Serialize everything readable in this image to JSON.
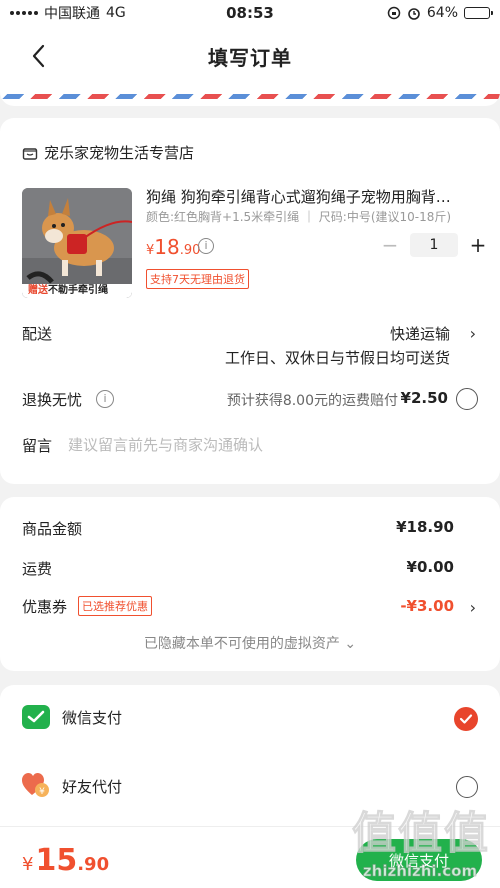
{
  "status_bar": {
    "carrier": "中国联通",
    "network": "4G",
    "time": "08:53",
    "battery": "64%",
    "battery_level": 0.64
  },
  "nav": {
    "title": "填写订单"
  },
  "shop": {
    "name": "宠乐家宠物生活专营店"
  },
  "product": {
    "title": "狗绳 狗狗牵引绳背心式遛狗绳子宠物用胸背…",
    "spec": "颜色:红色胸背+1.5米牵引绳 ｜ 尺码:中号(建议10-18斤)",
    "price_symbol": "¥",
    "price_int": "18",
    "price_dec": ".90",
    "quantity": "1",
    "return_badge": "支持7天无理由退货",
    "image_caption_red": "赠送",
    "image_caption": "不勒手牵引绳"
  },
  "delivery": {
    "label": "配送",
    "method": "快递运输",
    "note": "工作日、双休日与节假日均可送货"
  },
  "exchange": {
    "label": "退换无忧",
    "note": "预计获得8.00元的运费赔付",
    "price": "¥2.50"
  },
  "memo": {
    "label": "留言",
    "placeholder": "建议留言前先与商家沟通确认"
  },
  "price_detail": {
    "goods_label": "商品金额",
    "goods_value": "¥18.90",
    "shipping_label": "运费",
    "shipping_value": "¥0.00",
    "coupon_label": "优惠券",
    "coupon_tag": "已选推荐优惠",
    "coupon_value": "-¥3.00",
    "hidden_note": "已隐藏本单不可使用的虚拟资产 ⌄"
  },
  "payment": {
    "wechat_label": "微信支付",
    "friend_label": "好友代付",
    "wechat_icon": "wechat-pay-icon",
    "friend_icon": "friend-pay-icon"
  },
  "bottom": {
    "symbol": "¥",
    "total_int": "15",
    "total_dec": ".90",
    "button_label": "微信支付"
  },
  "watermark": {
    "text": "值",
    "site": "zhizhizhi.com"
  },
  "colors": {
    "accent": "#f0502f",
    "wechat_green": "#22b14c",
    "check_red": "#e8452c"
  }
}
